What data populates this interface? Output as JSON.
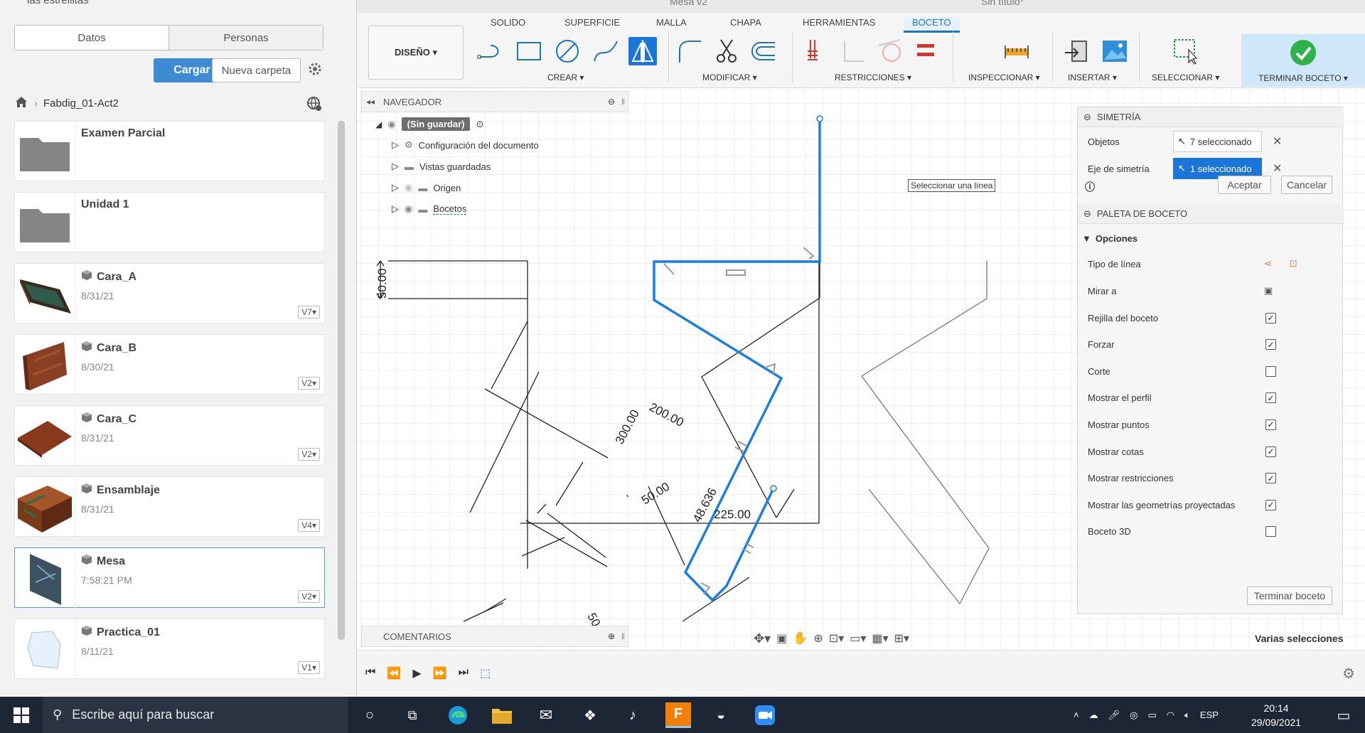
{
  "left_panel": {
    "project_name": "las estrellitas",
    "tabs": [
      {
        "label": "Datos"
      },
      {
        "label": "Personas"
      }
    ],
    "upload_label": "Cargar",
    "new_folder_label": "Nueva carpeta",
    "breadcrumb": "Fabdig_01-Act2",
    "items": [
      {
        "name": "Examen Parcial",
        "date": "",
        "version": "",
        "kind": "folder"
      },
      {
        "name": "Unidad 1",
        "date": "",
        "version": "",
        "kind": "folder"
      },
      {
        "name": "Cara_A",
        "date": "8/31/21",
        "version": "V7",
        "kind": "design"
      },
      {
        "name": "Cara_B",
        "date": "8/30/21",
        "version": "V2",
        "kind": "design"
      },
      {
        "name": "Cara_C",
        "date": "8/31/21",
        "version": "V2",
        "kind": "design"
      },
      {
        "name": "Ensamblaje",
        "date": "8/31/21",
        "version": "V4",
        "kind": "design"
      },
      {
        "name": "Mesa",
        "date": "7:58:21 PM",
        "version": "V2",
        "kind": "design"
      },
      {
        "name": "Practica_01",
        "date": "8/11/21",
        "version": "V1",
        "kind": "design"
      }
    ]
  },
  "doc_tabs": {
    "tab1": "Mesa v2",
    "tab2": "Sin título*"
  },
  "ribbon": {
    "tabs": [
      "SOLIDO",
      "SUPERFICIE",
      "MALLA",
      "CHAPA",
      "HERRAMIENTAS",
      "BOCETO"
    ],
    "design_label": "DISEÑO ▾",
    "groups": [
      "CREAR ▾",
      "MODIFICAR ▾",
      "RESTRICCIONES ▾",
      "INSPECCIONAR ▾",
      "INSERTAR ▾",
      "SELECCIONAR ▾"
    ],
    "finish_label": "TERMINAR BOCETO ▾",
    "accent": "#1c75bc"
  },
  "navigator": {
    "title": "NAVEGADOR",
    "root": "(Sin guardar)",
    "nodes": [
      "Configuración del documento",
      "Vistas guardadas",
      "Origen",
      "Bocetos"
    ]
  },
  "comments_label": "COMENTARIOS",
  "canvas": {
    "tooltip": "Seleccionar una línea",
    "dims": {
      "d50": "50.00",
      "d300": "300.00",
      "d200": "200.00",
      "d50b": "50.00",
      "d48": "48.636",
      "d225": "225.00",
      "d50c": "50"
    }
  },
  "palette": {
    "symmetry_title": "SIMETRÍA",
    "objects_label": "Objetos",
    "objects_value": "7 seleccionado",
    "axis_label": "Eje de simetría",
    "axis_value": "1 seleccionado",
    "ok_label": "Aceptar",
    "cancel_label": "Cancelar",
    "palette_title": "PALETA DE BOCETO",
    "options_title": "Opciones",
    "line_type": "Tipo de línea",
    "look_at": "Mirar a",
    "options": [
      {
        "label": "Rejilla del boceto",
        "checked": true
      },
      {
        "label": "Forzar",
        "checked": true
      },
      {
        "label": "Corte",
        "checked": false
      },
      {
        "label": "Mostrar el perfil",
        "checked": true
      },
      {
        "label": "Mostrar puntos",
        "checked": true
      },
      {
        "label": "Mostrar cotas",
        "checked": true
      },
      {
        "label": "Mostrar restricciones",
        "checked": true
      },
      {
        "label": "Mostrar las geometrías proyectadas",
        "checked": true
      },
      {
        "label": "Boceto 3D",
        "checked": false
      }
    ],
    "finish_sketch": "Terminar boceto"
  },
  "status_text": "Varias selecciones",
  "taskbar": {
    "search_placeholder": "Escribe aquí para buscar",
    "language": "ESP",
    "time": "20:14",
    "date": "29/09/2021"
  }
}
